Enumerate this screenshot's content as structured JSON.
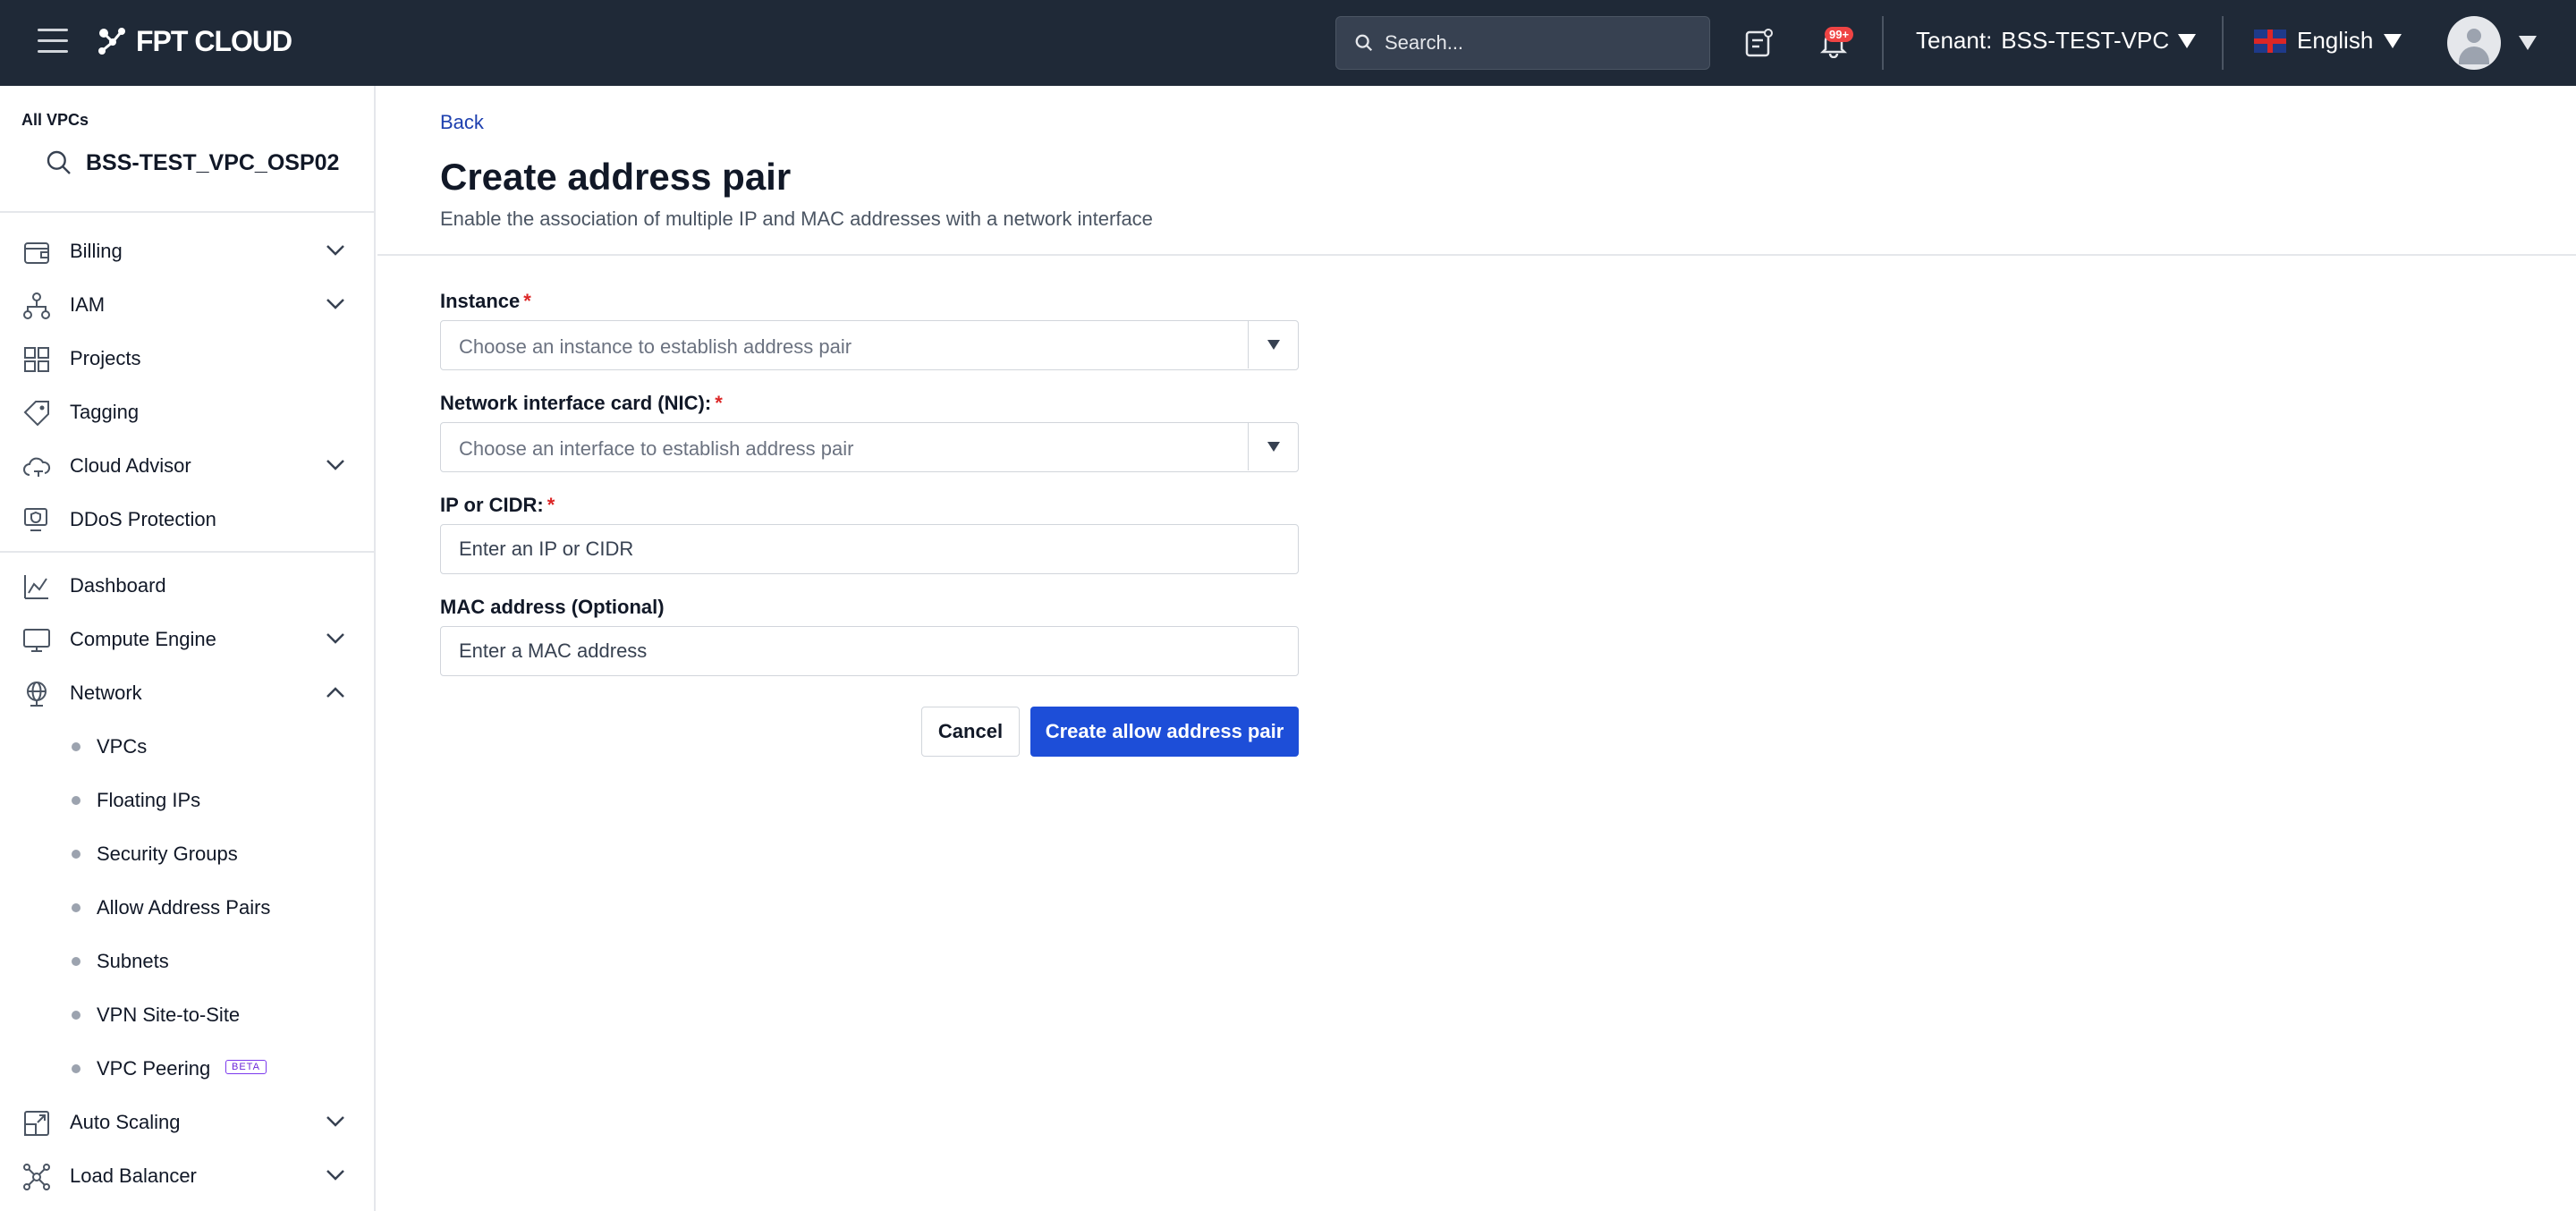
{
  "header": {
    "logo_text": "FPT CLOUD",
    "search_placeholder": "Search...",
    "notification_count": "99+",
    "tenant_label": "Tenant:",
    "tenant_value": "BSS-TEST-VPC",
    "language": "English"
  },
  "sidebar": {
    "vpc_label": "All VPCs",
    "vpc_name": "BSS-TEST_VPC_OSP02",
    "group1": [
      {
        "label": "Billing",
        "icon": "billing-icon",
        "expandable": true
      },
      {
        "label": "IAM",
        "icon": "iam-icon",
        "expandable": true
      },
      {
        "label": "Projects",
        "icon": "projects-icon",
        "expandable": false
      },
      {
        "label": "Tagging",
        "icon": "tag-icon",
        "expandable": false
      },
      {
        "label": "Cloud Advisor",
        "icon": "cloud-icon",
        "expandable": true
      },
      {
        "label": "DDoS Protection",
        "icon": "ddos-icon",
        "expandable": false
      }
    ],
    "group2": [
      {
        "label": "Dashboard",
        "icon": "chart-icon",
        "expandable": true
      },
      {
        "label": "Compute Engine",
        "icon": "monitor-icon",
        "expandable": true
      },
      {
        "label": "Network",
        "icon": "globe-icon",
        "expandable": true,
        "expanded": true
      }
    ],
    "network_sub": [
      {
        "label": "VPCs"
      },
      {
        "label": "Floating IPs"
      },
      {
        "label": "Security Groups"
      },
      {
        "label": "Allow Address Pairs"
      },
      {
        "label": "Subnets"
      },
      {
        "label": "VPN Site-to-Site"
      },
      {
        "label": "VPC Peering",
        "badge": "BETA"
      }
    ],
    "group3": [
      {
        "label": "Auto Scaling",
        "icon": "autoscaling-icon",
        "expandable": true
      },
      {
        "label": "Load Balancer",
        "icon": "loadbalancer-icon",
        "expandable": true
      }
    ]
  },
  "page": {
    "back": "Back",
    "title": "Create address pair",
    "subtitle": "Enable the association of multiple IP and MAC addresses with a network interface"
  },
  "form": {
    "instance": {
      "label": "Instance",
      "placeholder": "Choose an instance to establish address pair"
    },
    "nic": {
      "label": "Network interface card (NIC):",
      "placeholder": "Choose an interface to establish address pair"
    },
    "ip": {
      "label": "IP or CIDR:",
      "placeholder": "Enter an IP or CIDR"
    },
    "mac": {
      "label": "MAC address (Optional)",
      "placeholder": "Enter a MAC address"
    },
    "cancel": "Cancel",
    "submit": "Create allow address pair"
  },
  "colors": {
    "topbar": "#1f2937",
    "primary": "#1d4ed8",
    "required": "#dc2626"
  }
}
